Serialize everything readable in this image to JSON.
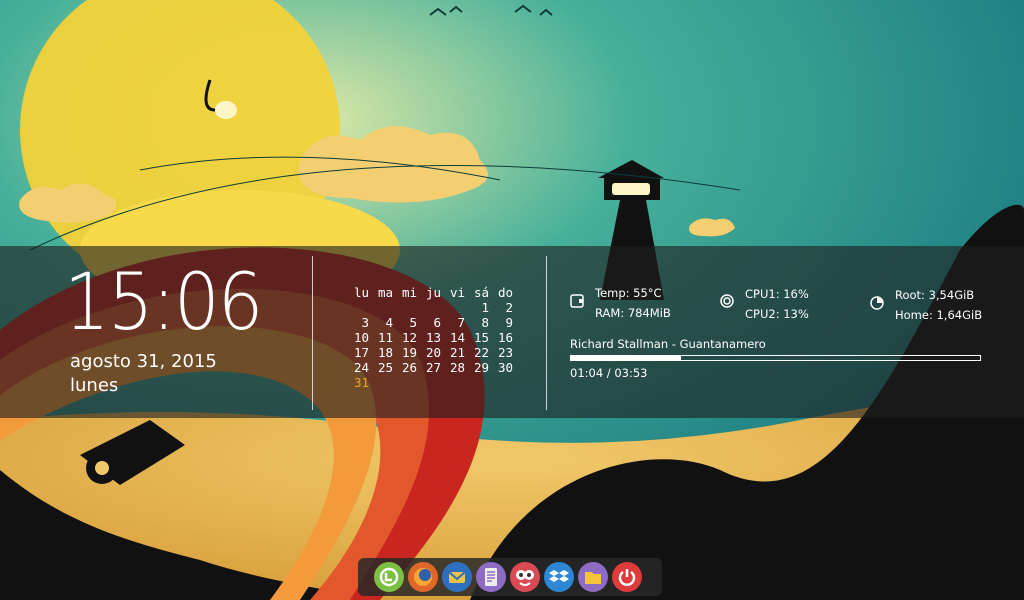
{
  "clock": {
    "time": "15:06",
    "date": "agosto 31, 2015",
    "day": "lunes"
  },
  "calendar": {
    "weekdays": [
      "lu",
      "ma",
      "mi",
      "ju",
      "vi",
      "sá",
      "do"
    ],
    "weeks": [
      [
        "",
        "",
        "",
        "",
        "",
        "1",
        "2"
      ],
      [
        "3",
        "4",
        "5",
        "6",
        "7",
        "8",
        "9"
      ],
      [
        "10",
        "11",
        "12",
        "13",
        "14",
        "15",
        "16"
      ],
      [
        "17",
        "18",
        "19",
        "20",
        "21",
        "22",
        "23"
      ],
      [
        "24",
        "25",
        "26",
        "27",
        "28",
        "29",
        "30"
      ],
      [
        "31",
        "",
        "",
        "",
        "",
        "",
        ""
      ]
    ],
    "today": "31"
  },
  "system": {
    "temp": "Temp: 55°C",
    "ram": "RAM: 784MiB",
    "cpu1": "CPU1: 16%",
    "cpu2": "CPU2: 13%",
    "root": "Root: 3,54GiB",
    "home": "Home: 1,64GiB"
  },
  "music": {
    "track": "Richard Stallman - Guantanamero",
    "position": "01:04 / 03:53",
    "progress": 0.27
  },
  "dock": {
    "items": [
      {
        "name": "mint-menu-icon",
        "color": "#7bc043"
      },
      {
        "name": "firefox-icon",
        "color": "#e0662a"
      },
      {
        "name": "thunderbird-icon",
        "color": "#2f6fc0"
      },
      {
        "name": "text-editor-icon",
        "color": "#8e6cc4"
      },
      {
        "name": "pidgin-icon",
        "color": "#d94a55"
      },
      {
        "name": "dropbox-icon",
        "color": "#2d86d6"
      },
      {
        "name": "file-manager-icon",
        "color": "#8e6cc4"
      },
      {
        "name": "power-icon",
        "color": "#e03a3a"
      }
    ]
  }
}
